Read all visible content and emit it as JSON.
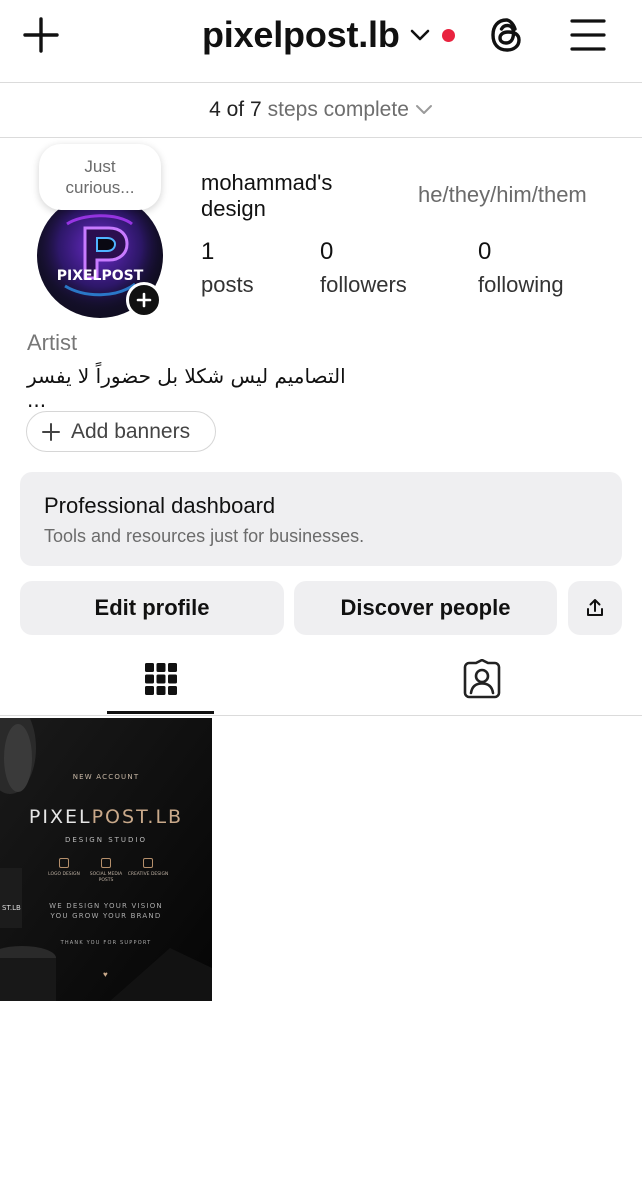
{
  "header": {
    "username": "pixelpost.lb",
    "steps_count": "4 of 7",
    "steps_label": "steps complete"
  },
  "profile": {
    "note": [
      "Just",
      "curious..."
    ],
    "display_name": "mohammad's design",
    "pronouns": "he/they/him/them",
    "stats": [
      {
        "value": "1",
        "label": "posts"
      },
      {
        "value": "0",
        "label": "followers"
      },
      {
        "value": "0",
        "label": "following"
      }
    ],
    "category": "Artist",
    "bio": "التصاميم ليس شكلا بل حضوراً لا يفسر ...",
    "avatar_text": "PIXELPOST"
  },
  "buttons": {
    "add_banners": "Add banners",
    "edit_profile": "Edit profile",
    "discover_people": "Discover people"
  },
  "dashboard": {
    "title": "Professional dashboard",
    "subtitle": "Tools and resources just for businesses."
  },
  "post": {
    "kicker": "NEW ACCOUNT",
    "brand_main": "PIXEL",
    "brand_accent": "POST.LB",
    "studio": "DESIGN STUDIO",
    "services": [
      "LOGO DESIGN",
      "SOCIAL MEDIA POSTS",
      "CREATIVE DESIGN"
    ],
    "tagline1": "WE DESIGN YOUR VISION",
    "tagline2": "YOU GROW YOUR BRAND",
    "thanks": "THANK YOU FOR SUPPORT",
    "side_text": "ST.LB"
  },
  "colors": {
    "notification_dot": "#e9233f",
    "button_bg": "#efeff1",
    "accent_gold": "#c9a98a"
  },
  "icons": {
    "create": "plus-icon",
    "account_switch": "chevron-down-icon",
    "threads": "threads-icon",
    "menu": "hamburger-menu-icon",
    "share": "share-icon",
    "grid_tab": "grid-icon",
    "tagged_tab": "tagged-person-icon"
  }
}
